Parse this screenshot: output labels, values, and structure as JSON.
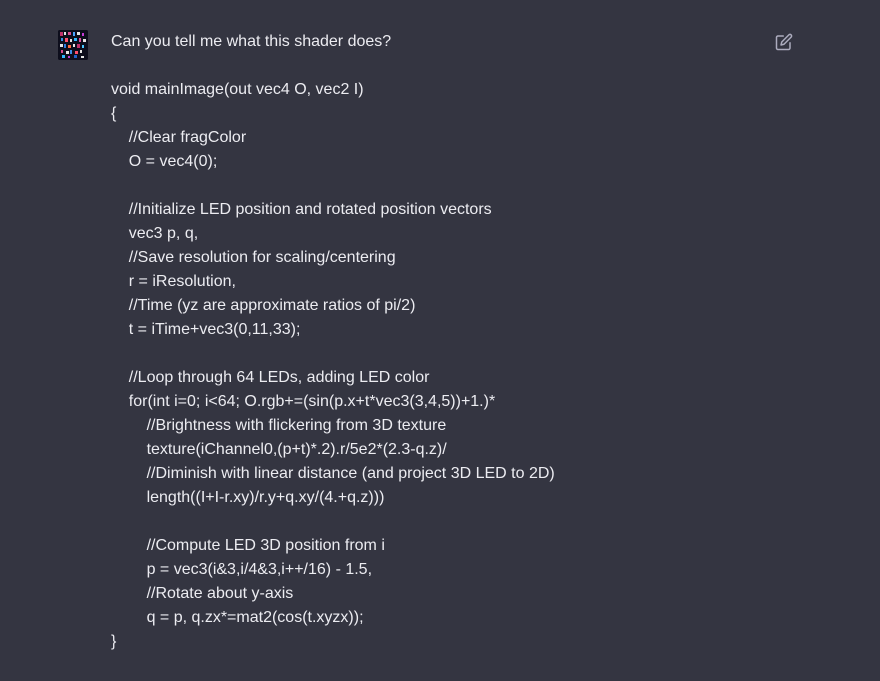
{
  "message": {
    "question": "Can you tell me what this shader does?",
    "code_lines": [
      "void mainImage(out vec4 O, vec2 I)",
      "{",
      "    //Clear fragColor",
      "    O = vec4(0);",
      "",
      "    //Initialize LED position and rotated position vectors",
      "    vec3 p, q,",
      "    //Save resolution for scaling/centering",
      "    r = iResolution,",
      "    //Time (yz are approximate ratios of pi/2)",
      "    t = iTime+vec3(0,11,33);",
      "",
      "    //Loop through 64 LEDs, adding LED color",
      "    for(int i=0; i<64; O.rgb+=(sin(p.x+t*vec3(3,4,5))+1.)*",
      "        //Brightness with flickering from 3D texture",
      "        texture(iChannel0,(p+t)*.2).r/5e2*(2.3-q.z)/",
      "        //Diminish with linear distance (and project 3D LED to 2D)",
      "        length((I+I-r.xy)/r.y+q.xy/(4.+q.z)))",
      "",
      "        //Compute LED 3D position from i",
      "        p = vec3(i&3,i/4&3,i++/16) - 1.5,",
      "        //Rotate about y-axis",
      "        q = p, q.zx*=mat2(cos(t.xyzx));",
      "}"
    ]
  },
  "icons": {
    "avatar": "user-avatar-icon",
    "edit": "edit-icon"
  },
  "colors": {
    "background": "#343541",
    "text": "#ececf1",
    "icon": "#acacbe"
  }
}
